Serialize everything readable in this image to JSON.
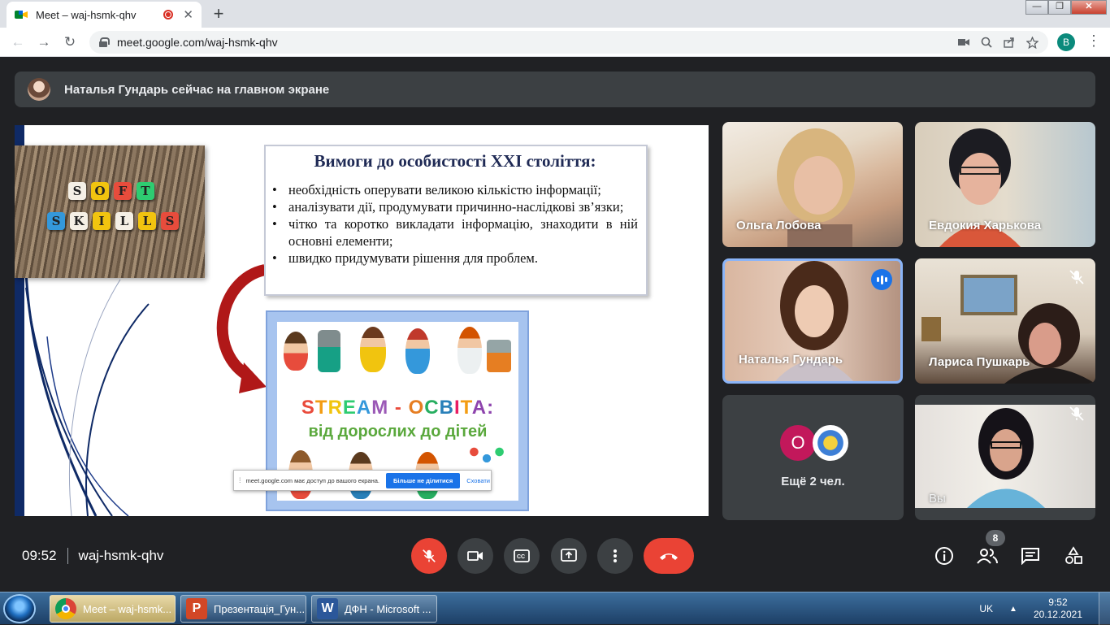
{
  "browser": {
    "tab_title": "Meet – waj-hsmk-qhv",
    "tab_close": "✕",
    "new_tab": "+",
    "url": "meet.google.com/waj-hsmk-qhv",
    "profile_initial": "B",
    "window_controls": {
      "minimize": "—",
      "maximize": "❐",
      "close": "✕"
    }
  },
  "banner": {
    "text": "Наталья Гундарь сейчас на главном экране"
  },
  "slide": {
    "soft_letters": [
      "S",
      "O",
      "F",
      "T"
    ],
    "skills_letters": [
      "S",
      "K",
      "I",
      "L",
      "L",
      "S"
    ],
    "req_title": "Вимоги до особистості XXI століття:",
    "req_items": [
      "необхідність оперувати великою кількістю інформації;",
      "аналізувати дії, продумувати причинно-наслідкові зв’язки;",
      "чітко та коротко викладати інформацію, знаходити в ній основні елементи;",
      "швидко придумувати рішення для проблем."
    ],
    "stream_title_parts": [
      {
        "t": "S",
        "c": "#e94b3c"
      },
      {
        "t": "T",
        "c": "#f39c12"
      },
      {
        "t": "R",
        "c": "#f1c40f"
      },
      {
        "t": "E",
        "c": "#2ecc71"
      },
      {
        "t": "A",
        "c": "#3498db"
      },
      {
        "t": "M",
        "c": "#9b59b6"
      },
      {
        "t": " - ",
        "c": "#e94b3c"
      },
      {
        "t": "О",
        "c": "#e67e22"
      },
      {
        "t": "С",
        "c": "#27ae60"
      },
      {
        "t": "В",
        "c": "#2980b9"
      },
      {
        "t": "І",
        "c": "#e91e63"
      },
      {
        "t": "Т",
        "c": "#f39c12"
      },
      {
        "t": "А:",
        "c": "#8e44ad"
      }
    ],
    "stream_subtitle": "від дорослих до дітей"
  },
  "share_bar": {
    "grip": "⁞",
    "message": "meet.google.com має доступ до вашого екрана.",
    "stop": "Більше не ділитися",
    "hide": "Сховати"
  },
  "participants": [
    {
      "name": "Ольга Лобова"
    },
    {
      "name": "Евдокия Харькова"
    },
    {
      "name": "Наталья Гундарь"
    },
    {
      "name": "Лариса Пушкарь"
    },
    {
      "name": "Вы"
    }
  ],
  "more_tile": {
    "initial": "О",
    "caption": "Ещё 2 чел."
  },
  "footer": {
    "time": "09:52",
    "meeting_code": "waj-hsmk-qhv",
    "people_count": "8"
  },
  "taskbar": {
    "items": [
      {
        "label": "Meet – waj-hsmk..."
      },
      {
        "label": "Презентація_Гун..."
      },
      {
        "label": "ДФН - Microsoft ..."
      }
    ],
    "lang": "UK",
    "tray_arrow": "▲",
    "time": "9:52",
    "date": "20.12.2021"
  },
  "colors": {
    "meet_bg": "#202124",
    "end_call": "#ea4335",
    "accent_blue": "#1a73e8"
  }
}
